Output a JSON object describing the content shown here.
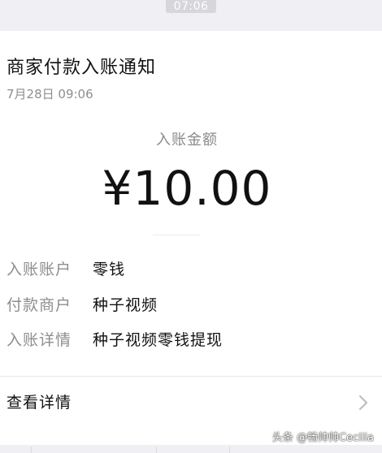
{
  "status": {
    "time": "07:06"
  },
  "notice": {
    "title": "商家付款入账通知",
    "timestamp": "7月28日  09:06",
    "amount_label": "入账金额",
    "amount": "¥10.00",
    "details": [
      {
        "key": "入账账户",
        "value": "零钱"
      },
      {
        "key": "付款商户",
        "value": "种子视频"
      },
      {
        "key": "入账详情",
        "value": "种子视频零钱提现"
      }
    ],
    "view_details": "查看详情",
    "chevron_icon": "chevron-right-icon"
  },
  "watermark": {
    "text": "头条 @畅帅帅Cecilia"
  },
  "colors": {
    "background": "#efeff4",
    "card": "#ffffff",
    "secondary_text": "#8e8e8e",
    "primary_text": "#111111"
  }
}
